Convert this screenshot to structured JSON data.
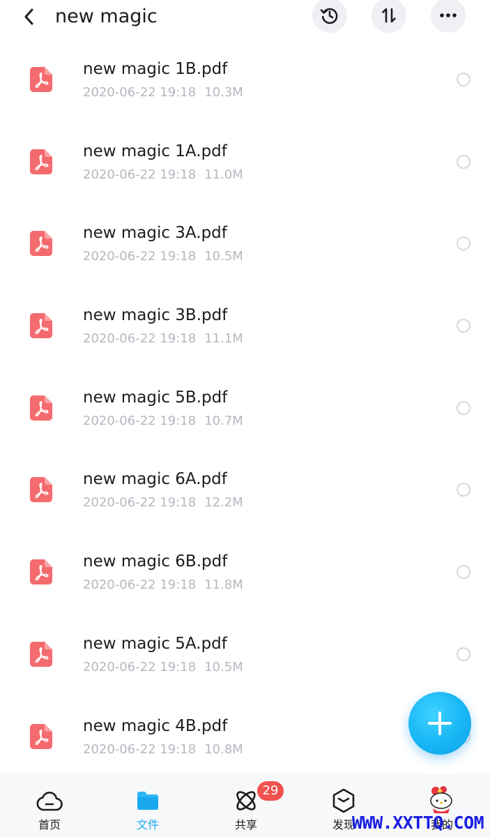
{
  "header": {
    "title": "new magic",
    "back_icon": "chevron-left-icon",
    "history_icon": "history-icon",
    "sort_icon": "sort-icon",
    "more_icon": "more-icon"
  },
  "files": [
    {
      "name": "new magic 1B.pdf",
      "date": "2020-06-22 19:18",
      "size": "10.3M"
    },
    {
      "name": "new magic 1A.pdf",
      "date": "2020-06-22 19:18",
      "size": "11.0M"
    },
    {
      "name": "new magic 3A.pdf",
      "date": "2020-06-22 19:18",
      "size": "10.5M"
    },
    {
      "name": "new magic 3B.pdf",
      "date": "2020-06-22 19:18",
      "size": "11.1M"
    },
    {
      "name": "new magic 5B.pdf",
      "date": "2020-06-22 19:18",
      "size": "10.7M"
    },
    {
      "name": "new magic 6A.pdf",
      "date": "2020-06-22 19:18",
      "size": "12.2M"
    },
    {
      "name": "new magic 6B.pdf",
      "date": "2020-06-22 19:18",
      "size": "11.8M"
    },
    {
      "name": "new magic 5A.pdf",
      "date": "2020-06-22 19:18",
      "size": "10.5M"
    },
    {
      "name": "new magic 4B.pdf",
      "date": "2020-06-22 19:18",
      "size": "10.8M"
    }
  ],
  "nav": {
    "home": "首页",
    "files": "文件",
    "share": "共享",
    "share_badge": "29",
    "discover": "发现",
    "mine": "我的"
  },
  "watermark": "WWW.XXTTQ.COM",
  "colors": {
    "accent": "#1aa8f0",
    "pdf_icon": "#f46b6e",
    "badge": "#f0524f",
    "meta_text": "#b4b8bf"
  }
}
